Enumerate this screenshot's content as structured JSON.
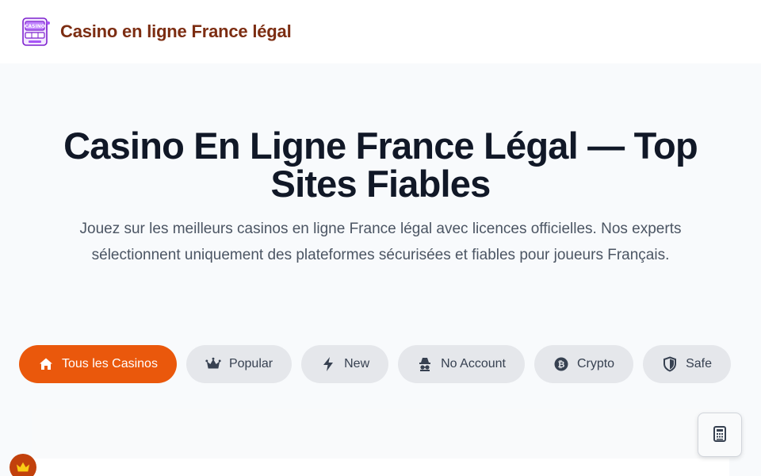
{
  "header": {
    "logo_icon": "casino-slot-machine-icon",
    "logo_text": "CASINO",
    "brand": "Casino en ligne France légal"
  },
  "hero": {
    "title": "Casino En Ligne France Légal — Top Sites Fiables",
    "subtitle": "Jouez sur les meilleurs casinos en ligne France légal avec licences officielles. Nos experts sélectionnent uniquement des plateformes sécurisées et fiables pour joueurs Français."
  },
  "filters": [
    {
      "label": "Tous les Casinos",
      "icon": "home-icon",
      "active": true
    },
    {
      "label": "Popular",
      "icon": "crown-icon",
      "active": false
    },
    {
      "label": "New",
      "icon": "bolt-icon",
      "active": false
    },
    {
      "label": "No Account",
      "icon": "incognito-icon",
      "active": false
    },
    {
      "label": "Crypto",
      "icon": "bitcoin-icon",
      "active": false
    },
    {
      "label": "Safe",
      "icon": "shield-icon",
      "active": false
    }
  ],
  "floating": {
    "calculator_icon": "calculator-icon",
    "badge_icon": "crown-icon"
  },
  "colors": {
    "accent": "#ea580c",
    "brand_text": "#7c2d12",
    "pill_bg": "#e5e7eb",
    "hero_bg": "#f8fafc"
  }
}
